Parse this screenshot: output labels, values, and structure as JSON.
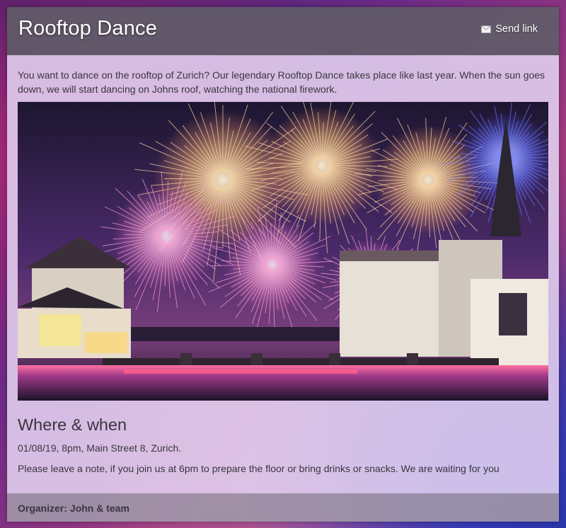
{
  "header": {
    "title": "Rooftop Dance",
    "send_link": {
      "icon": "envelope-icon",
      "label": "Send link"
    }
  },
  "body": {
    "intro": "You want to dance on the rooftop of Zurich? Our legendary Rooftop Dance takes place like last year. When the sun goes down, we will start dancing on Johns roof, watching the national firework.",
    "section_title": "Where & when",
    "when": "01/08/19, 8pm, Main Street 8, Zurich.",
    "note": "Please leave a note, if you join us at 6pm to prepare the floor or bring drinks or snacks. We are waiting for you"
  },
  "footer": {
    "organizer": "Organizer: John & team"
  },
  "colors": {
    "header_bg": "#5f5c68",
    "body_bg": "#e2d2f0",
    "footer_bg": "#a096a8",
    "text": "#3a3540",
    "firework_gold": "#ffd9a0",
    "firework_blue": "#6f7cff",
    "firework_pink": "#ff9fd6"
  }
}
